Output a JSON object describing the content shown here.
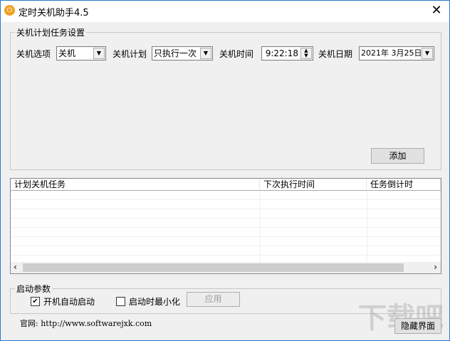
{
  "window": {
    "title": "定时关机助手4.5",
    "close": "✕"
  },
  "schedule_group": {
    "title": "关机计划任务设置",
    "option_label": "关机选项",
    "option_value": "关机",
    "plan_label": "关机计划",
    "plan_value": "只执行一次",
    "time_label": "关机时间",
    "time_value": "9:22:18",
    "date_label": "关机日期",
    "date_value": "2021年 3月25日",
    "add_button": "添加"
  },
  "task_list": {
    "columns": [
      "计划关机任务",
      "下次执行时间",
      "任务倒计时"
    ],
    "rows": []
  },
  "startup_group": {
    "title": "启动参数",
    "autostart_label": "开机自动启动",
    "autostart_checked": true,
    "minimize_label": "启动时最小化",
    "minimize_checked": false,
    "apply_button": "应用"
  },
  "footer": {
    "website": "官网: http://www.softwarejxk.com",
    "hide_button": "隐藏界面"
  },
  "watermark": "下载吧 www.xiazaiba.com"
}
